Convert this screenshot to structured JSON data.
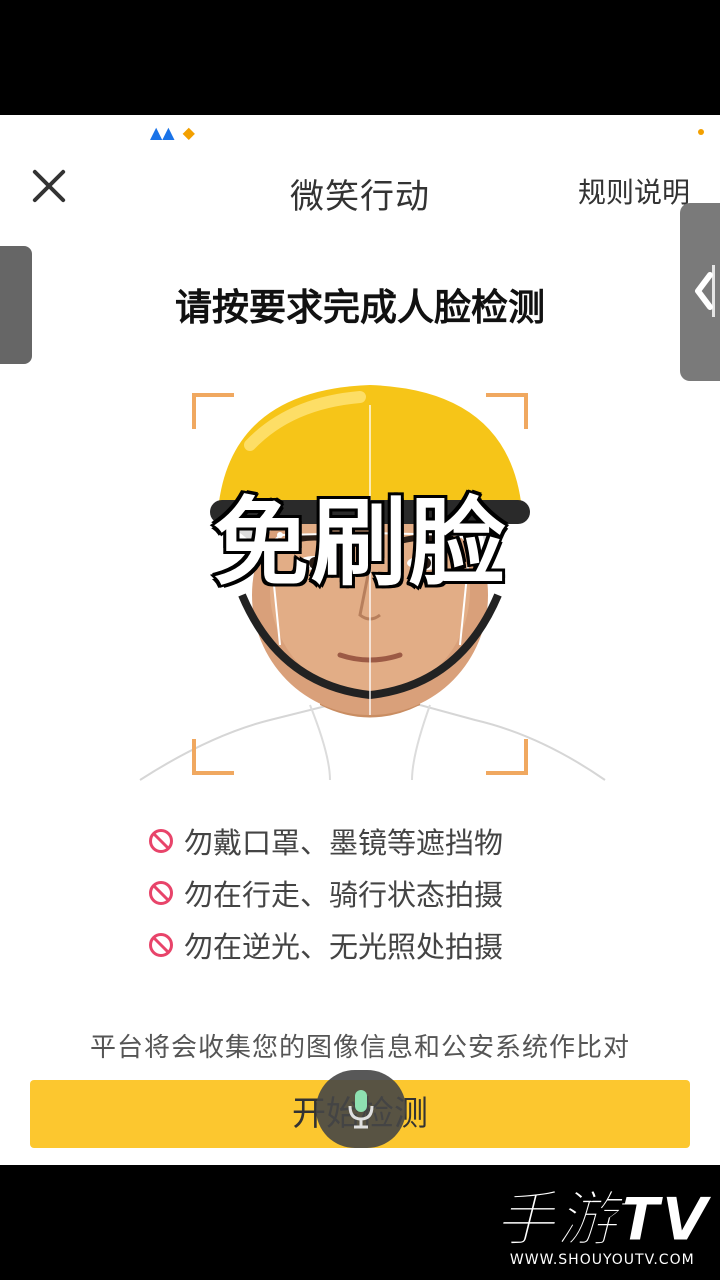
{
  "app": {
    "nav_title": "微笑行动",
    "rules_link": "规则说明",
    "heading": "请按要求完成人脸检测",
    "overlay_caption": "免刷脸",
    "tips": [
      "勿戴口罩、墨镜等遮挡物",
      "勿在行走、骑行状态拍摄",
      "勿在逆光、无光照处拍摄"
    ],
    "disclaimer": "平台将会收集您的图像信息和公安系统作比对",
    "start_button": "开始检测"
  },
  "watermark": {
    "main": "手游TV",
    "url": "WWW.SHOUYOUTV.COM"
  },
  "colors": {
    "accent": "#fcc72f",
    "corner_frame": "#f0a860",
    "warning": "#e8446a"
  },
  "icons": {
    "close": "close-icon",
    "mic": "microphone-icon",
    "no_entry": "no-entry-icon",
    "chevron": "chevron-left-icon"
  }
}
